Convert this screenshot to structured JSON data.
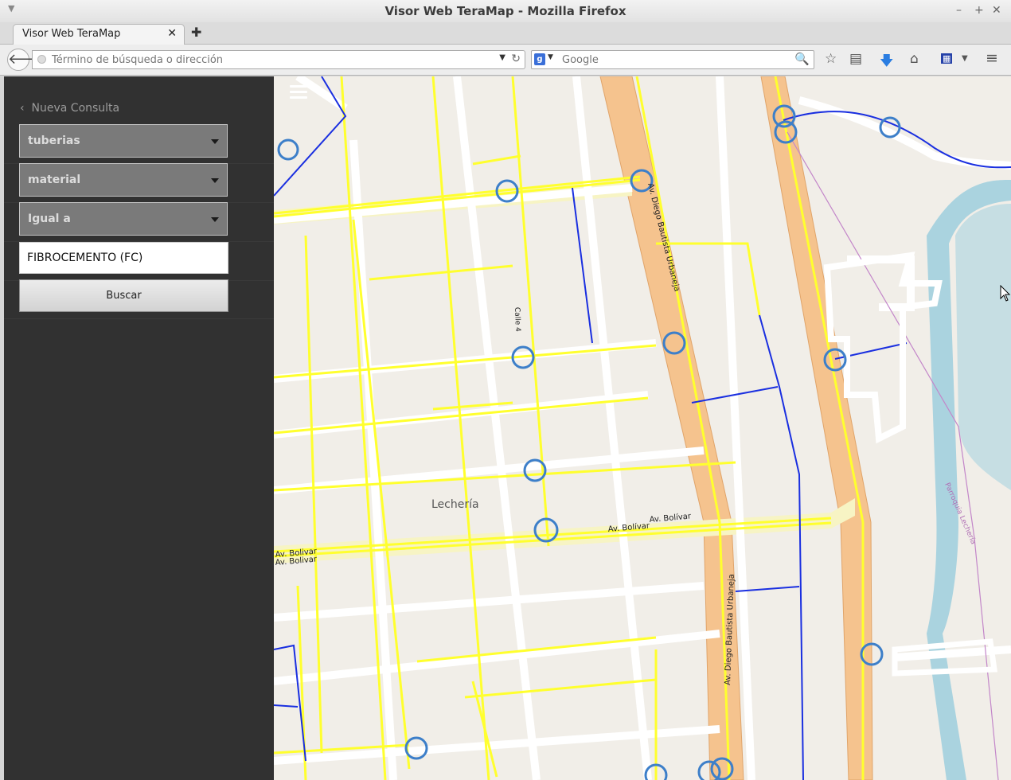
{
  "window": {
    "title": "Visor Web TeraMap - Mozilla Firefox"
  },
  "tabs": [
    {
      "label": "Visor Web TeraMap"
    }
  ],
  "navbar": {
    "url_placeholder": "Término de búsqueda o dirección",
    "search_placeholder": "Google",
    "search_engine_icon": "g"
  },
  "sidebar": {
    "back_label": "Nueva Consulta",
    "layer_select": "tuberias",
    "field_select": "material",
    "operator_select": "Igual a",
    "value_input": "FIBROCEMENTO (FC)",
    "search_button": "Buscar"
  },
  "map": {
    "place_label": "Lechería",
    "street_labels": [
      "Av. Diego Bautista Urbaneja",
      "Av. Diego Bautista Urbaneja",
      "Av. Bolívar",
      "Av. Bolívar",
      "Av. Bolivar",
      "Av. Bolivar",
      "Calle 4",
      "Parroquia Lechería"
    ],
    "colors": {
      "background": "#f1eee8",
      "street": "#ffffff",
      "highlighted_pipes": "#ffff2e",
      "blue_pipes": "#1a2fe0",
      "avenue": "#f5c38e",
      "water": "#aad3df",
      "valve": "#3d7fc9"
    }
  }
}
